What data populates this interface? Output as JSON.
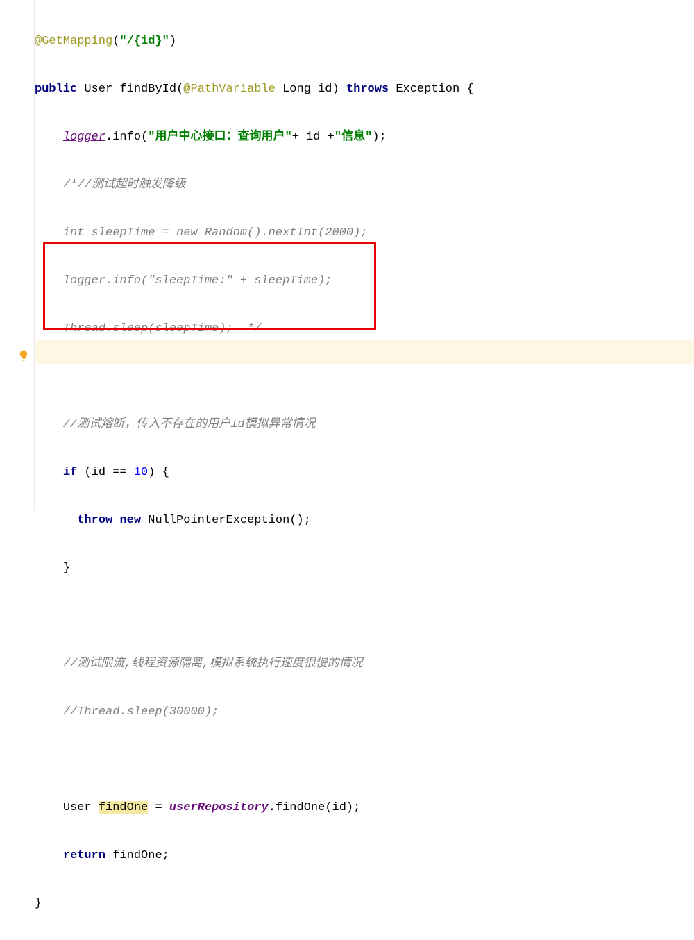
{
  "line1": {
    "annotation": "@GetMapping",
    "paren_open": "(",
    "str": "\"/{id}\"",
    "paren_close": ")"
  },
  "line2": {
    "kw_public": "public",
    "sp1": " ",
    "type_user": "User",
    "sp2": " ",
    "method": "findById",
    "paren_open": "(",
    "ann_pv": "@PathVariable",
    "sp3": " ",
    "type_long": "Long",
    "sp4": " ",
    "param": "id",
    "paren_close": ")",
    "sp5": " ",
    "kw_throws": "throws",
    "sp6": " ",
    "type_ex": "Exception",
    "sp7": " ",
    "brace": "{"
  },
  "line3": {
    "indent": "    ",
    "logger": "logger",
    "dot": ".",
    "info": "info",
    "paren_open": "(",
    "str1": "\"用户中心接口：查询用户\"",
    "plus1": "+ id +",
    "str2": "\"信息\"",
    "paren_close_semi": ");"
  },
  "line4": {
    "indent": "    ",
    "comment": "/*//测试超时触发降级"
  },
  "line5": {
    "indent": "    ",
    "comment": "int sleepTime = new Random().nextInt(2000);"
  },
  "line6": {
    "indent": "    ",
    "comment": "logger.info(\"sleepTime:\" + sleepTime);"
  },
  "line7": {
    "indent": "    ",
    "comment": "Thread.sleep(sleepTime);  */"
  },
  "line9": {
    "indent": "    ",
    "comment": "//测试熔断，传入不存在的用户id模拟异常情况"
  },
  "line10": {
    "indent": "    ",
    "kw_if": "if",
    "sp1": " ",
    "paren_open": "(",
    "id": "id",
    "sp2": " ",
    "eq": "==",
    "sp3": " ",
    "num": "10",
    "paren_close": ")",
    "sp4": " ",
    "brace": "{"
  },
  "line11": {
    "indent": "      ",
    "kw_throw": "throw",
    "sp1": " ",
    "kw_new": "new",
    "sp2": " ",
    "type_npe": "NullPointerException",
    "parens": "();"
  },
  "line12": {
    "indent": "    ",
    "brace": "}"
  },
  "line14": {
    "indent": "    ",
    "comment": "//测试限流,线程资源隔离,模拟系统执行速度很慢的情况"
  },
  "line15": {
    "indent": "    ",
    "comment": "//Thread.sleep(30000);"
  },
  "line17": {
    "indent": "    ",
    "type_user": "User",
    "sp1": " ",
    "findone": "findOne",
    "sp2": " ",
    "eq": "=",
    "sp3": " ",
    "repo": "userRepository",
    "dot": ".",
    "method": "findOne",
    "paren_open": "(",
    "id": "id",
    "paren_close_semi": ");"
  },
  "line18": {
    "indent": "    ",
    "kw_return": "return",
    "sp1": " ",
    "findone": "findOne",
    "semi": ";"
  },
  "line19": {
    "brace": "}"
  }
}
